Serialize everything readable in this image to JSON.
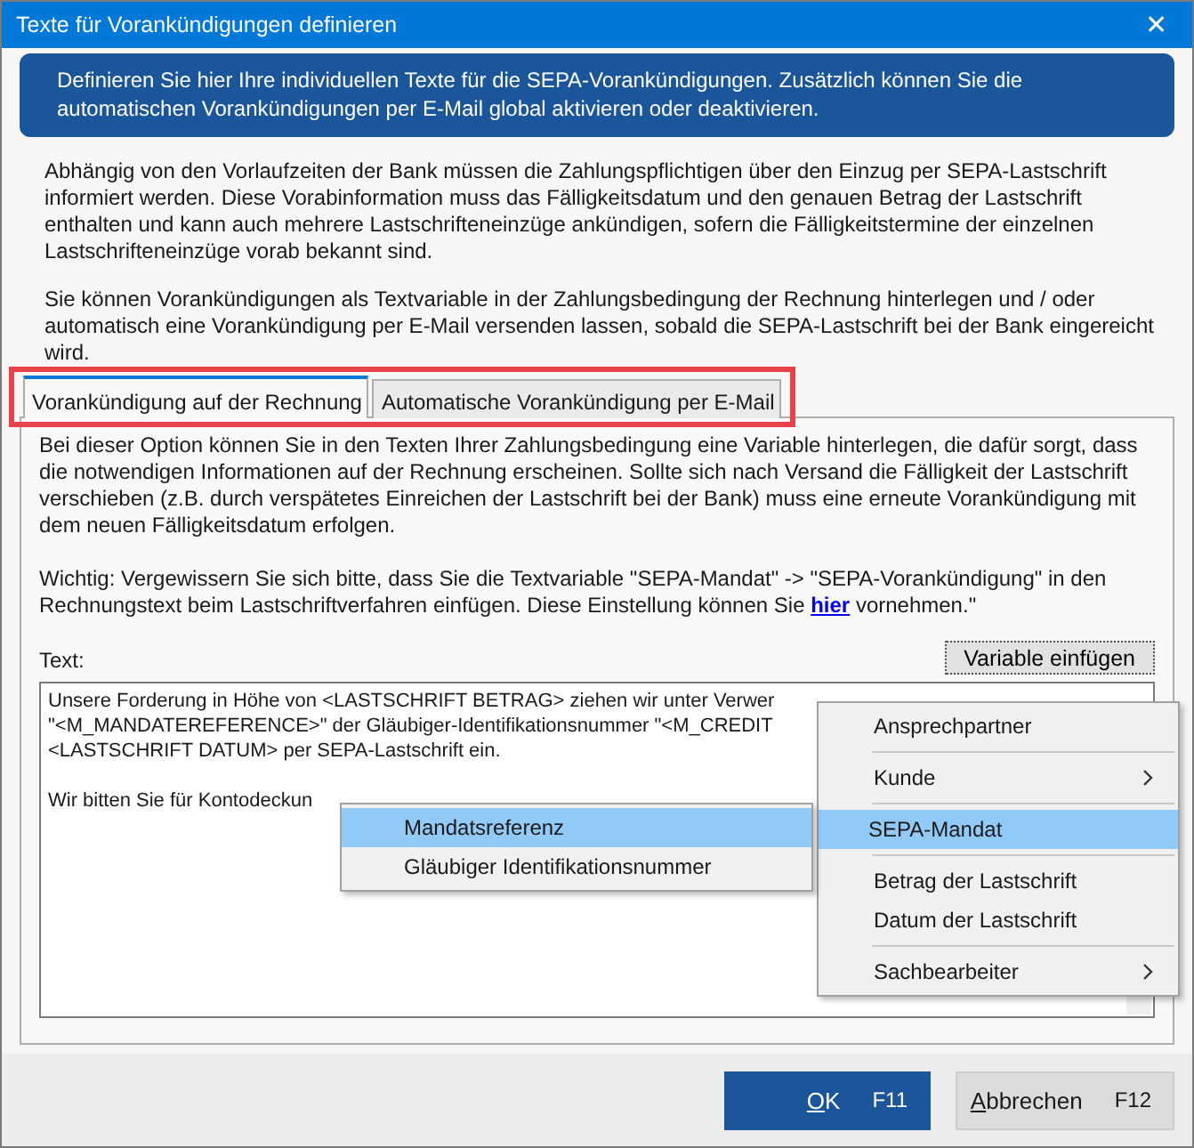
{
  "window": {
    "title": "Texte für Vorankündigungen definieren",
    "close": "✕"
  },
  "banner": "Definieren Sie hier Ihre individuellen Texte für die SEPA-Vorankündigungen. Zusätzlich können Sie die automatischen Vorankündigungen per E-Mail global aktivieren oder deaktivieren.",
  "intro": [
    "Abhängig von den Vorlaufzeiten der Bank müssen die Zahlungspflichtigen über den Einzug per SEPA-Lastschrift informiert werden. Diese Vorabinformation muss das Fälligkeitsdatum und den genauen Betrag der Lastschrift enthalten und kann auch mehrere Lastschrifteneinzüge ankündigen, sofern die Fälligkeitstermine der einzelnen Lastschrifteneinzüge vorab bekannt sind.",
    "Sie können Vorankündigungen als Textvariable in der Zahlungsbedingung der Rechnung hinterlegen und / oder automatisch eine Vorankündigung per E-Mail versenden lassen, sobald die SEPA-Lastschrift bei der Bank eingereicht wird."
  ],
  "tabs": [
    {
      "label": "Vorankündigung auf der Rechnung",
      "selected": true
    },
    {
      "label": "Automatische Vorankündigung per E-Mail",
      "selected": false
    }
  ],
  "panel": {
    "text": "Bei dieser Option können Sie in den Texten Ihrer Zahlungsbedingung eine Variable hinterlegen, die dafür sorgt, dass die notwendigen Informationen auf der Rechnung erscheinen. Sollte sich nach Versand die Fälligkeit der Lastschrift verschieben (z.B. durch verspätetes Einreichen der Lastschrift bei der Bank) muss eine erneute Vorankündigung mit dem neuen Fälligkeitsdatum erfolgen.",
    "note": {
      "before": "Wichtig: Vergewissern Sie sich bitte, dass Sie die Textvariable \"SEPA-Mandat\" -> \"SEPA-Vorankündigung\" in den Rechnungstext beim Lastschriftverfahren einfügen. Diese Einstellung können Sie ",
      "link": "hier",
      "after": " vornehmen.\""
    },
    "text_label": "Text:",
    "insert_button": "Variable einfügen",
    "editor_lines": [
      "Unsere Forderung in Höhe von <LASTSCHRIFT BETRAG> ziehen wir unter Verwer",
      "\"<M_MANDATEREFERENCE>\" der Gläubiger-Identifikationsnummer \"<M_CREDIT",
      "<LASTSCHRIFT DATUM> per SEPA-Lastschrift ein.",
      "Wir bitten Sie für Kontodeckun"
    ]
  },
  "menu": [
    {
      "label": "Ansprechpartner",
      "submenu": false,
      "selected": false,
      "separator_after": true
    },
    {
      "label": "Kunde",
      "submenu": true,
      "selected": false,
      "separator_after": true
    },
    {
      "label": "SEPA-Mandat",
      "submenu": false,
      "selected": true,
      "separator_after": true
    },
    {
      "label": "Betrag der Lastschrift",
      "submenu": false,
      "selected": false,
      "separator_after": false
    },
    {
      "label": "Datum der Lastschrift",
      "submenu": false,
      "selected": false,
      "separator_after": true
    },
    {
      "label": "Sachbearbeiter",
      "submenu": true,
      "selected": false,
      "separator_after": false
    }
  ],
  "submenu": [
    {
      "label": "Mandatsreferenz",
      "selected": true
    },
    {
      "label": "Gläubiger Identifikationsnummer",
      "selected": false
    }
  ],
  "buttons": [
    {
      "mnemonic": "O",
      "rest": "K",
      "shortcut": "F11",
      "primary": true
    },
    {
      "mnemonic": "A",
      "rest": "bbrechen",
      "shortcut": "F12",
      "primary": false
    }
  ]
}
